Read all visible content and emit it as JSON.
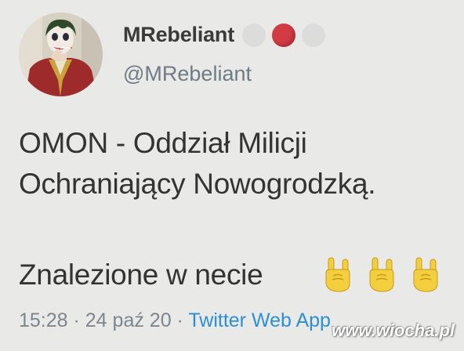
{
  "tweet": {
    "author": {
      "display_name": "MRebeliant",
      "handle": "@MRebeliant",
      "avatar_icon": "joker-avatar",
      "name_emoji": [
        "white-circle",
        "red-circle",
        "white-circle"
      ]
    },
    "text_lines": [
      "OMON - Oddział Milicji",
      "Ochraniający Nowogrodzką.",
      "Znalezione w necie"
    ],
    "text_emoji": [
      "sign-of-horns",
      "sign-of-horns",
      "sign-of-horns"
    ],
    "meta": {
      "time": "15:28",
      "separator": " · ",
      "date": "24 paź 20",
      "source": "Twitter Web App"
    }
  },
  "watermark": "www.wiocha.pl",
  "colors": {
    "background": "#e9eae7",
    "text": "#333333",
    "muted": "#7c868f",
    "link": "#2c8fd4",
    "emoji_red": "#d23a44",
    "emoji_yellow": "#f4cf3d"
  }
}
